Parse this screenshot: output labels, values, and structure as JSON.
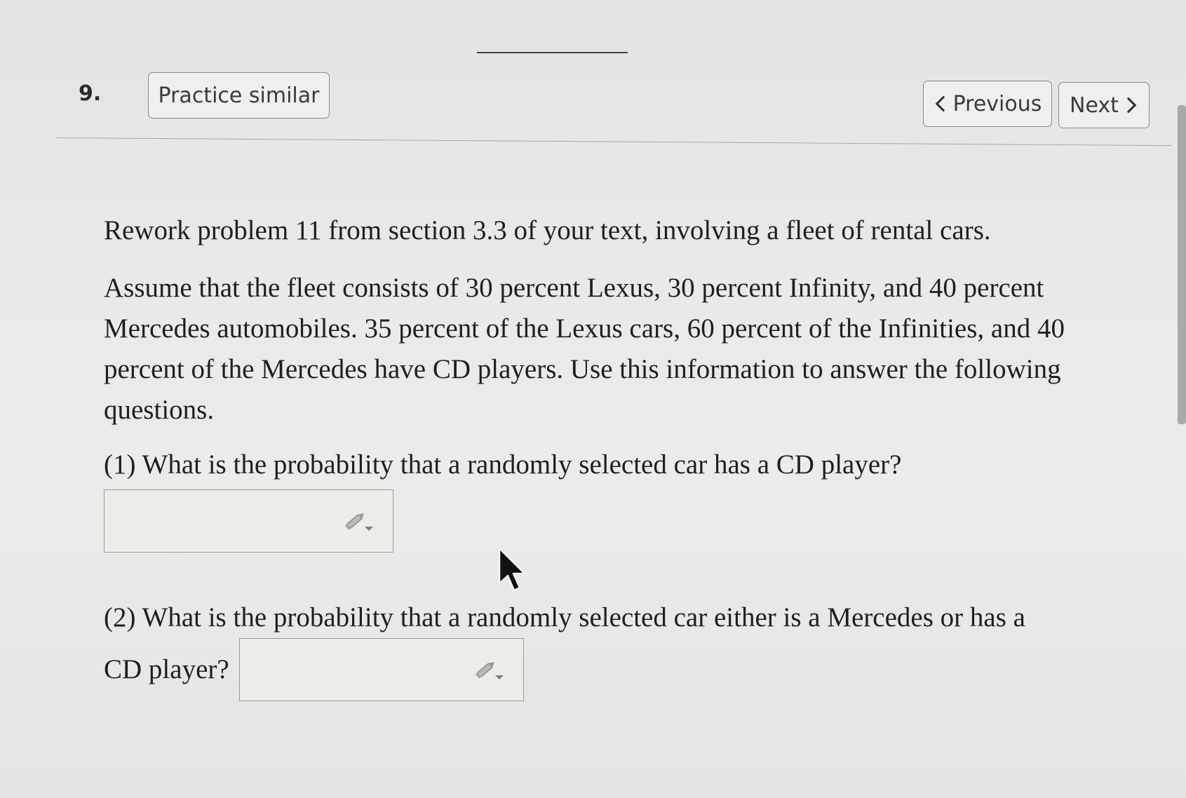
{
  "header": {
    "question_number": "9.",
    "practice_similar_label": "Practice similar",
    "previous_label": "Previous",
    "next_label": "Next"
  },
  "problem": {
    "intro": "Rework problem 11 from section 3.3 of your text, involving a fleet of rental cars.",
    "assumptions": "Assume that the fleet consists of 30 percent Lexus, 30 percent Infinity, and 40 percent Mercedes automobiles. 35 percent of the Lexus cars, 60 percent of the Infinities, and 40 percent of the Mercedes have CD players. Use this information to answer the following questions.",
    "question_1": "(1) What is the probability that a randomly selected car has a CD player?",
    "question_2_part1": "(2) What is the probability that a randomly selected car either is a Mercedes or has a",
    "question_2_part2": "CD player?"
  },
  "answers": {
    "answer_1_value": "",
    "answer_2_value": ""
  },
  "icons": {
    "answer_tool": "pencil-dropdown-icon",
    "prev": "chevron-left-icon",
    "next": "chevron-right-icon",
    "cursor": "mouse-pointer-icon"
  },
  "colors": {
    "background": "#e9e9e7",
    "text": "#1f1f1f",
    "border": "#8a8a8a"
  }
}
